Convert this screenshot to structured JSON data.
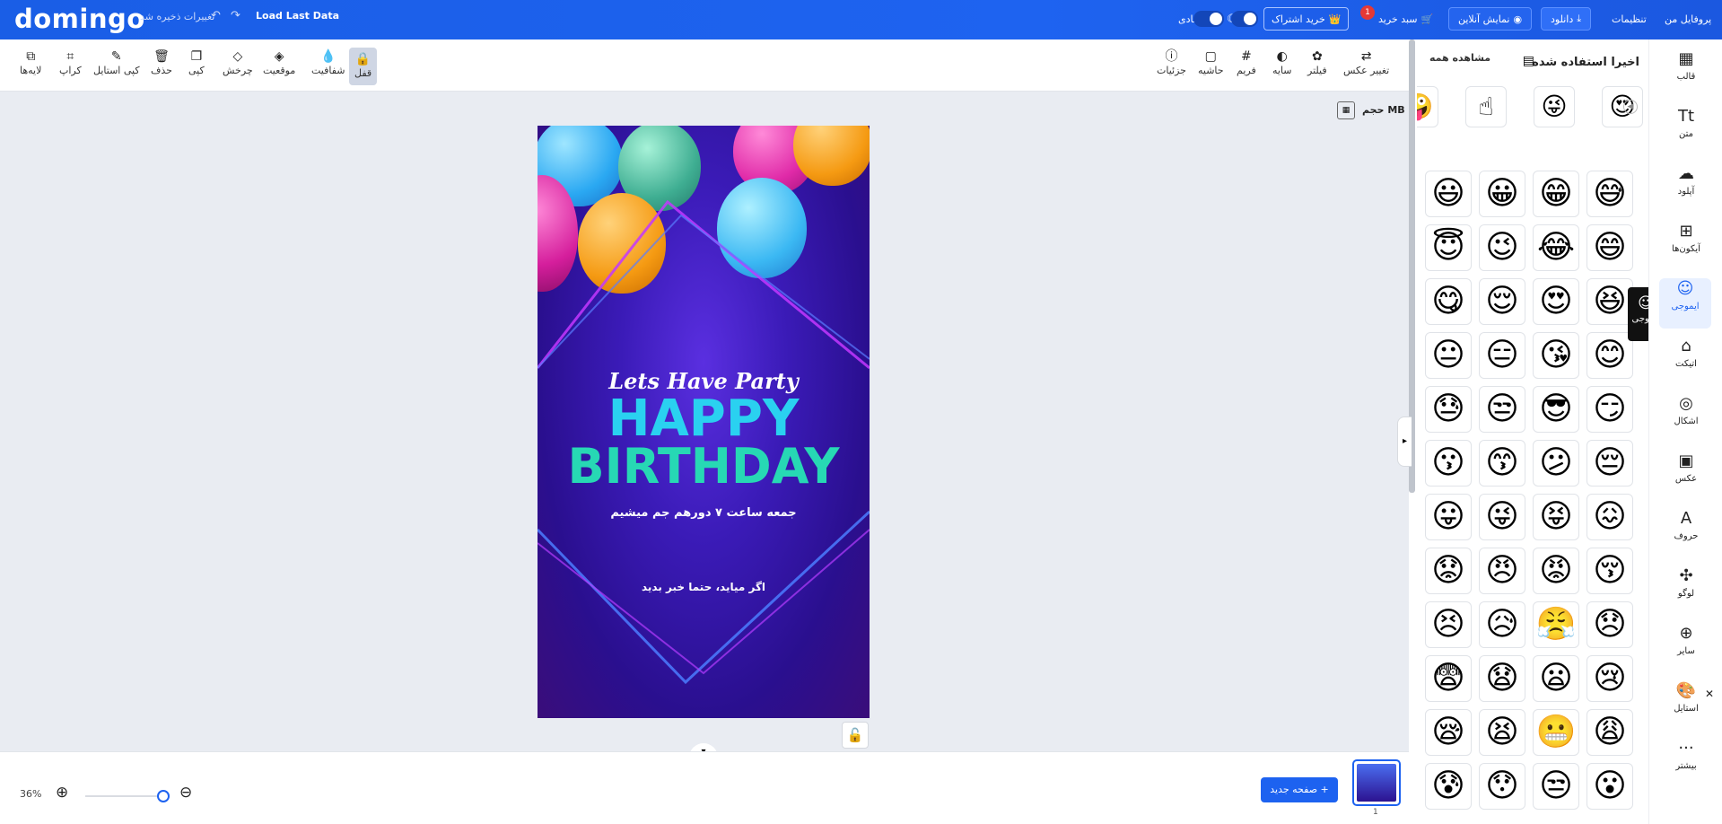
{
  "topbar": {
    "logo": "domingo",
    "saved_text": "تغییرات ذخیره شد",
    "undo_icon": "↶",
    "redo_icon": "↷",
    "load_last_data": "Load Last Data",
    "theme_label": "عادی",
    "subscribe_label": "خرید اشتراک",
    "cart_label": "سبد خرید",
    "cart_badge": "1",
    "live_label": "نمایش آنلاین",
    "download_label": "دانلود",
    "settings_label": "تنظیمات",
    "profile_label": "پروفایل من"
  },
  "toolbar": {
    "left_tools": [
      {
        "label": "لایه‌ها",
        "icon": "⧉"
      },
      {
        "label": "کراپ",
        "icon": "⌗"
      },
      {
        "label": "کپی استایل",
        "icon": "✎"
      },
      {
        "label": "حذف",
        "icon": "🗑"
      },
      {
        "label": "کپی",
        "icon": "❐"
      },
      {
        "label": "چرخش",
        "icon": "◇"
      },
      {
        "label": "موقعیت",
        "icon": "◈"
      },
      {
        "label": "شفافیت",
        "icon": "💧"
      },
      {
        "label": "قفل",
        "icon": "🔒"
      }
    ],
    "right_tools": [
      {
        "label": "جزئیات",
        "icon": "ⓘ"
      },
      {
        "label": "حاشیه",
        "icon": "▢"
      },
      {
        "label": "فریم",
        "icon": "#"
      },
      {
        "label": "سایه",
        "icon": "◐"
      },
      {
        "label": "فیلتر",
        "icon": "✿"
      },
      {
        "label": "تغییر عکس",
        "icon": "⇄"
      }
    ]
  },
  "canvas": {
    "size_label": "حجم MB",
    "design_title": "Lets Have Party",
    "happy": "HAPPY",
    "birthday": "BIRTHDAY",
    "line1": "جمعه ساعت ۷ دورهم جم میشیم",
    "line2": "اگر میاید، حتما خبر بدید",
    "lock_icon": "🔓",
    "collapse_icon": "▾"
  },
  "bottom": {
    "zoom_pct": "36%",
    "zoom_in_icon": "⊕",
    "zoom_out_icon": "⊖",
    "zoom_level": 0.36,
    "new_page_label": "صفحه جدید  +",
    "page_number": "1"
  },
  "panel": {
    "title": "اخیرا استفاده شده",
    "see_all": "مشاهده همه",
    "recent": [
      "😍",
      "😜",
      "☝",
      "🤪"
    ],
    "emojis": [
      [
        "😅",
        "😁",
        "😀",
        "😃"
      ],
      [
        "😄",
        "😂",
        "😉",
        "😇"
      ],
      [
        "😆",
        "😍",
        "😌",
        "😋"
      ],
      [
        "😊",
        "😘",
        "😑",
        "😐"
      ],
      [
        "😏",
        "😎",
        "😒",
        "😓"
      ],
      [
        "😔",
        "😕",
        "😙",
        "😗"
      ],
      [
        "😖",
        "😝",
        "😜",
        "😛"
      ],
      [
        "😚",
        "😡",
        "😠",
        "😟"
      ],
      [
        "😞",
        "😤",
        "😥",
        "😣"
      ],
      [
        "😢",
        "😦",
        "😧",
        "😨"
      ],
      [
        "😩",
        "😬",
        "😫",
        "😪"
      ],
      [
        "😮",
        "😒",
        "😯",
        "😰"
      ]
    ],
    "tooltip": "ایموجی"
  },
  "sidenav": [
    {
      "label": "قالب",
      "icon": "▦"
    },
    {
      "label": "متن",
      "icon": "Tt"
    },
    {
      "label": "آپلود",
      "icon": "☁"
    },
    {
      "label": "آیکون‌ها",
      "icon": "⊞"
    },
    {
      "label": "ایموجی",
      "icon": "☺"
    },
    {
      "label": "اتیکت",
      "icon": "⌂"
    },
    {
      "label": "اشکال",
      "icon": "◎"
    },
    {
      "label": "عکس",
      "icon": "▣"
    },
    {
      "label": "حروف",
      "icon": "A"
    },
    {
      "label": "لوگو",
      "icon": "✣"
    },
    {
      "label": "سایر",
      "icon": "⊕"
    },
    {
      "label": "استایل",
      "icon": "🎨"
    },
    {
      "label": "بیشتر",
      "icon": "···"
    }
  ],
  "colors": {
    "brand": "#1d62f0",
    "happy": "#2ad1f0",
    "birthday": "#27d8b4"
  }
}
